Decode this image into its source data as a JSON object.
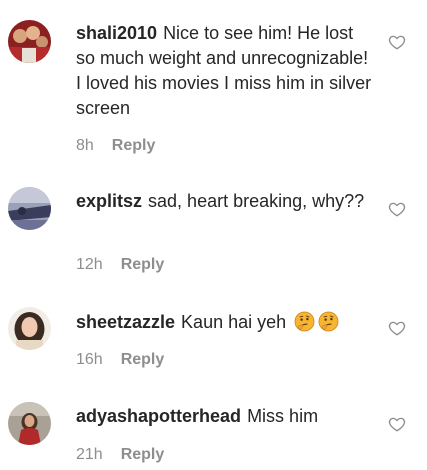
{
  "comments": [
    {
      "username": "shali2010",
      "text": "Nice to see him! He lost so much weight and unrecognizable! I loved his movies I miss him in silver screen",
      "time": "8h",
      "reply_label": "Reply"
    },
    {
      "username": "explitsz",
      "text": "sad, heart breaking, why??",
      "time": "12h",
      "reply_label": "Reply"
    },
    {
      "username": "sheetzazzle",
      "text": "Kaun hai yeh",
      "emoji": [
        "thinking-face",
        "thinking-face"
      ],
      "time": "16h",
      "reply_label": "Reply"
    },
    {
      "username": "adyashapotterhead",
      "text": "Miss him",
      "time": "21h",
      "reply_label": "Reply"
    }
  ],
  "icons": {
    "like": "heart-outline-icon"
  },
  "colors": {
    "text": "#262626",
    "secondary": "#8e8e8e",
    "emoji": "#f7b531"
  }
}
